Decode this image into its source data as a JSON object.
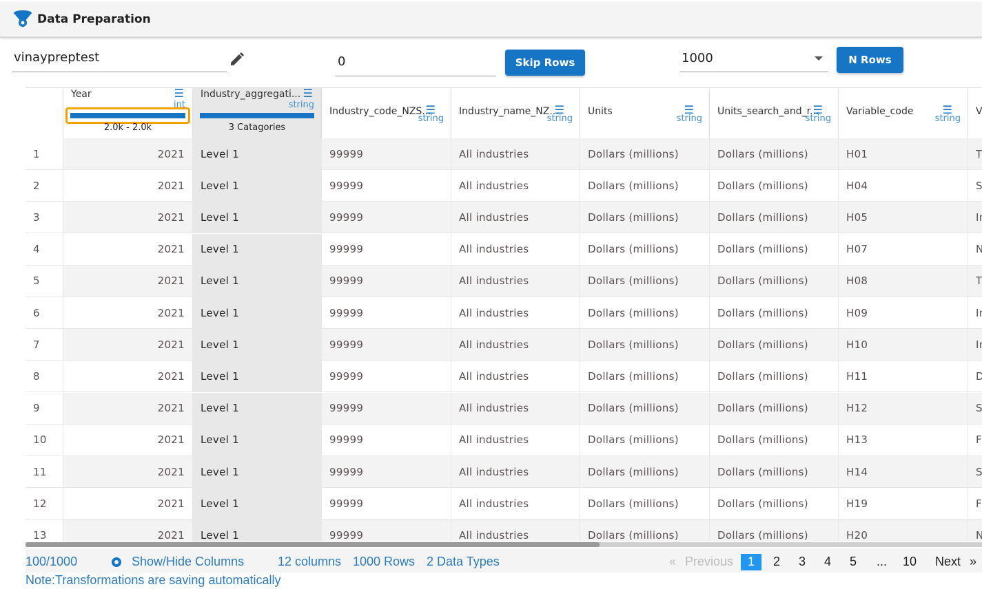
{
  "header": {
    "title": "Data Preparation"
  },
  "toolbar": {
    "name_value": "vinaypreptest",
    "skip_value": "0",
    "skip_label": "Skip Rows",
    "nrows_value": "1000",
    "nrows_label": "N Rows"
  },
  "columns": [
    {
      "name": "Year",
      "type": "int",
      "summary": "2.0k - 2.0k"
    },
    {
      "name": "Industry_aggregati...",
      "type": "string",
      "summary": "3 Catagories"
    },
    {
      "name": "Industry_code_NZS...",
      "type": "string"
    },
    {
      "name": "Industry_name_NZ...",
      "type": "string"
    },
    {
      "name": "Units",
      "type": "string"
    },
    {
      "name": "Units_search_and_r...",
      "type": "string"
    },
    {
      "name": "Variable_code",
      "type": "string"
    },
    {
      "name": "V",
      "type": ""
    }
  ],
  "rows": [
    [
      "1",
      "2021",
      "Level 1",
      "99999",
      "All industries",
      "Dollars (millions)",
      "Dollars (millions)",
      "H01",
      "T"
    ],
    [
      "2",
      "2021",
      "Level 1",
      "99999",
      "All industries",
      "Dollars (millions)",
      "Dollars (millions)",
      "H04",
      "S"
    ],
    [
      "3",
      "2021",
      "Level 1",
      "99999",
      "All industries",
      "Dollars (millions)",
      "Dollars (millions)",
      "H05",
      "In"
    ],
    [
      "4",
      "2021",
      "Level 1",
      "99999",
      "All industries",
      "Dollars (millions)",
      "Dollars (millions)",
      "H07",
      "N"
    ],
    [
      "5",
      "2021",
      "Level 1",
      "99999",
      "All industries",
      "Dollars (millions)",
      "Dollars (millions)",
      "H08",
      "T"
    ],
    [
      "6",
      "2021",
      "Level 1",
      "99999",
      "All industries",
      "Dollars (millions)",
      "Dollars (millions)",
      "H09",
      "In"
    ],
    [
      "7",
      "2021",
      "Level 1",
      "99999",
      "All industries",
      "Dollars (millions)",
      "Dollars (millions)",
      "H10",
      "In"
    ],
    [
      "8",
      "2021",
      "Level 1",
      "99999",
      "All industries",
      "Dollars (millions)",
      "Dollars (millions)",
      "H11",
      "D"
    ],
    [
      "9",
      "2021",
      "Level 1",
      "99999",
      "All industries",
      "Dollars (millions)",
      "Dollars (millions)",
      "H12",
      "S"
    ],
    [
      "10",
      "2021",
      "Level 1",
      "99999",
      "All industries",
      "Dollars (millions)",
      "Dollars (millions)",
      "H13",
      "F"
    ],
    [
      "11",
      "2021",
      "Level 1",
      "99999",
      "All industries",
      "Dollars (millions)",
      "Dollars (millions)",
      "H14",
      "S"
    ],
    [
      "12",
      "2021",
      "Level 1",
      "99999",
      "All industries",
      "Dollars (millions)",
      "Dollars (millions)",
      "H19",
      "F"
    ],
    [
      "13",
      "2021",
      "Level 1",
      "99999",
      "All industries",
      "Dollars (millions)",
      "Dollars (millions)",
      "H20",
      "N"
    ]
  ],
  "footer": {
    "rows_shown": "100/1000",
    "show_hide": "Show/Hide Columns",
    "columns": "12 columns",
    "rows": "1000 Rows",
    "types": "2 Data Types",
    "note": "Note:Transformations are saving automatically"
  },
  "pagination": {
    "prev": "Previous",
    "pages": [
      "1",
      "2",
      "3",
      "4",
      "5",
      "...",
      "10"
    ],
    "next": "Next",
    "current": "1"
  }
}
